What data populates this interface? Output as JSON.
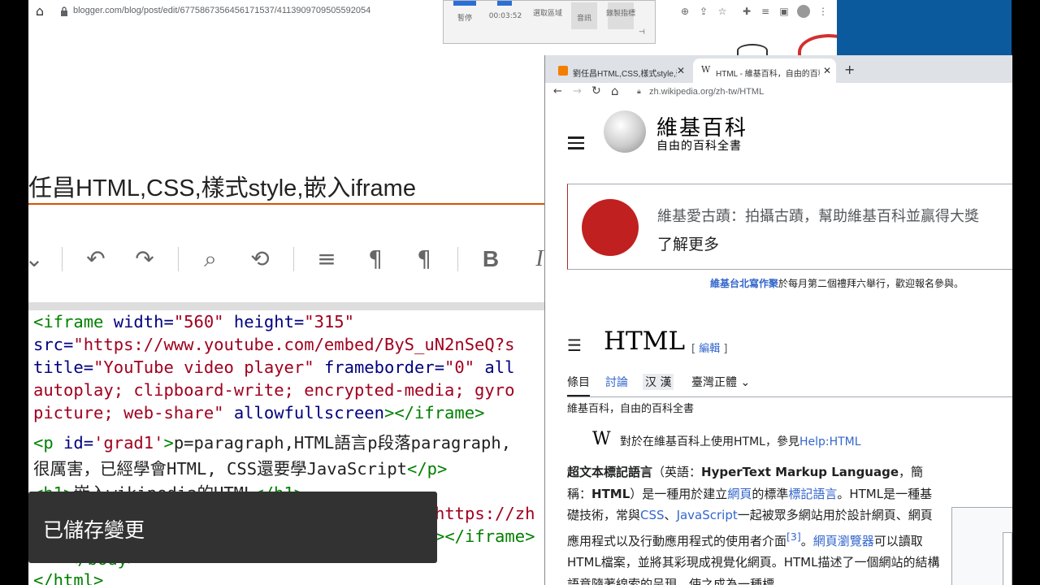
{
  "main": {
    "url": "blogger.com/blog/post/edit/6775867356456171537/4113909709505592054",
    "post_title": "任昌HTML,CSS,樣式style,嵌入iframe",
    "toast": "已儲存變更"
  },
  "recorder": {
    "pause": "暫停",
    "time": "00:03:52",
    "region": "選取區域",
    "audio": "音訊",
    "pointer": "錄製指標"
  },
  "code": {
    "l1": {
      "a": "<iframe ",
      "b": "width=",
      "c": "\"560\" ",
      "d": "height=",
      "e": "\"315\""
    },
    "l2": {
      "a": "src=",
      "b": "\"https://www.youtube.com/embed/ByS_uN2nSeQ?s"
    },
    "l3": {
      "a": "title=",
      "b": "\"YouTube video player\" ",
      "c": "frameborder=",
      "d": "\"0\" ",
      "e": "all"
    },
    "l4": "autoplay; clipboard-write; encrypted-media; gyro",
    "l5": {
      "a": "picture; web-share\" ",
      "b": "allowfullscreen",
      "c": "></iframe>"
    },
    "l6": {
      "a": "<p ",
      "b": "id=",
      "c": "'grad1'",
      "d": ">",
      "e": "p=paragraph,HTML語言p段落paragraph,"
    },
    "l7": {
      "a": "很厲害，已經學會HTML, CSS還要學JavaScript",
      "b": "</p>"
    },
    "l8": {
      "a": "<h1>",
      "b": "嵌入wikipedia的HTML",
      "c": "</h1>"
    },
    "l9": "https://zh",
    "l10": "></iframe>",
    "l11": "</body>",
    "l12": "</html>"
  },
  "wiki": {
    "tab1": "劉任昌HTML,CSS,樣式style,嵌入",
    "tab2": "HTML - 維基百科，自由的百科全書",
    "url": "zh.wikipedia.org/zh-tw/HTML",
    "site_name": "維基百科",
    "site_tagline": "自由的百科全書",
    "banner_text": "維基愛古蹟：拍攝古蹟，幫助維基百科並贏得大獎",
    "banner_more": "了解更多",
    "notice_link": "維基台北寫作聚",
    "notice_rest": "於每月第二個禮拜六舉行，歡迎報名參與。",
    "heading": "HTML",
    "edit_label": "編輯",
    "tab_article": "條目",
    "tab_talk": "討論",
    "tab_variant": "汉 漢",
    "tab_lang": "臺灣正體",
    "from_wp": "維基百科，自由的百科全書",
    "hatnote_prefix": "對於在維基百科上使用HTML，參見",
    "hatnote_link": "Help:HTML",
    "p1": "超文本標記語言",
    "p2": "（英語：",
    "p3": "HyperText Markup Language",
    "p4": "，簡稱：",
    "p5": "HTML",
    "p6": "）是一種用於建立",
    "p7": "網頁",
    "p8": "的標準",
    "p9": "標記語言",
    "p10": "。HTML是一種基礎技術，常與",
    "p11": "CSS",
    "p12": "、",
    "p13": "JavaScript",
    "p14": "一起被眾多網站用於設計網頁、網頁應用程式以及行動應用程式的使用者介面",
    "p15": "[3]",
    "p16": "。",
    "p17": "網頁瀏覽器",
    "p18": "可以讀取HTML檔案，並將其彩現成視覺化網頁。HTML描述了一個網站的結構語意隨著線索的呈現，使之成為一種標"
  },
  "colors": {
    "link": "#3366cc",
    "tag": "#008000",
    "attr": "#000080",
    "value": "#a0001e",
    "toast_bg": "#323232"
  }
}
